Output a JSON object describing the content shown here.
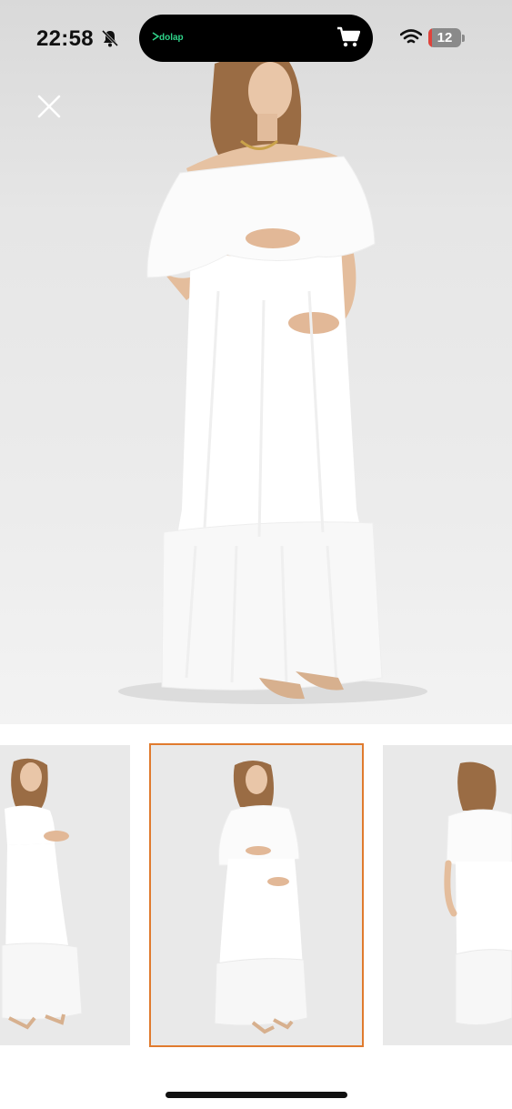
{
  "status_bar": {
    "time": "22:58",
    "battery_level": "12",
    "battery_fraction": 0.12,
    "icons": [
      "bell-off-icon",
      "wifi-icon",
      "battery-icon"
    ]
  },
  "dynamic_island": {
    "app_brand": "dolap",
    "icons": [
      "dolap-logo-icon",
      "cart-icon"
    ],
    "brand_color": "#2fd48a"
  },
  "viewer": {
    "close_icon": "close-icon",
    "main_photo": "model-in-white-off-shoulder-maxi-dress"
  },
  "thumbnails": [
    {
      "name": "front-left-view",
      "selected": false
    },
    {
      "name": "front-view",
      "selected": true
    },
    {
      "name": "back-view",
      "selected": false
    }
  ],
  "colors": {
    "selection_border": "#e07b2e",
    "battery_low": "#e0433b"
  }
}
